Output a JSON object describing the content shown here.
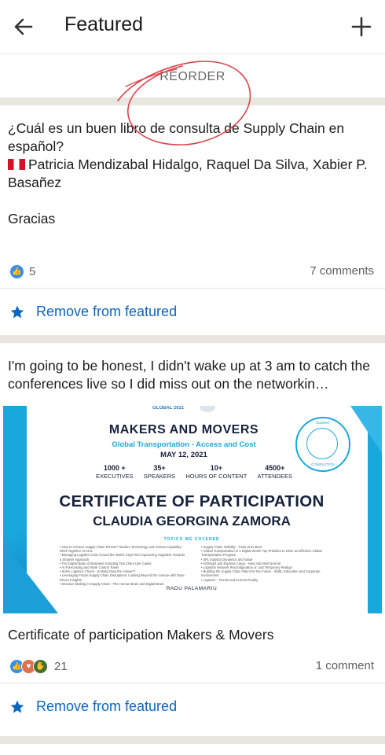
{
  "header": {
    "title": "Featured",
    "back_icon": "arrow-left-icon",
    "add_icon": "plus-icon"
  },
  "reorder": {
    "label": "REORDER"
  },
  "posts": [
    {
      "text_line1": "¿Cuál es un buen libro de consulta de Supply Chain en español?",
      "text_line2": "Patricia Mendizabal Hidalgo, Raquel Da Silva, Xabier P. Basañez",
      "text_line3": "Gracias",
      "reactions_count": "5",
      "comments": "7 comments",
      "remove_label": "Remove from featured"
    },
    {
      "text": "I'm going to be honest, I didn't wake up at 3 am to catch the conferences live so I did miss out on the networkin…",
      "certificate": {
        "logo_text": "GLOBAL 2021",
        "heading": "MAKERS AND MOVERS",
        "subheading": "Global Transportation - Access and Cost",
        "date": "MAY 12, 2021",
        "stats": [
          {
            "value": "1000 +",
            "label": "EXECUTIVES"
          },
          {
            "value": "35+",
            "label": "SPEAKERS"
          },
          {
            "value": "10+",
            "label": "HOURS OF CONTENT"
          },
          {
            "value": "4500+",
            "label": "ATTENDEES"
          }
        ],
        "title": "CERTIFICATE OF PARTICIPATION",
        "recipient": "CLAUDIA GEORGINA ZAMORA",
        "topics_label": "TOPICS WE COVERED",
        "topics_left": [
          "How to Achieve Supply Chain Fitness? Modern Technology and Human Capability - Work Together As One",
          "Managing Logistics Cost Around the World: Keys from Squeezing Suppliers Towards a Smarter Approach",
          "The Digital Brain of Business Including Two Client Use Cases",
          "AI Forecasting and Work Control Tower",
          "Solve Logistics Chaos - Is Mass Data the Answer?",
          "Leveraging Future Supply Chain Disruptions: Looking Beyond the Avenue with Data-Driven Insights",
          "Decision Making in Supply Chain - The Human Brain and Digital Brain"
        ],
        "topics_right": [
          "Supply Chain Visibility - Tools at Its Best",
          "Global Transportation in a Digital World: Top Priorities to Drive an Effective Global Transportation Program",
          "3PL Industry Dynamics and Value",
          "Airfreight and Express Cargo - New and Next Normal",
          "Logistics Network Reconfiguration or Just Temporary Realign",
          "Building the Supply Chain Talent for the Future - Skills, Education and Corporate Involvement",
          "Logitech - Trends and Current Reality"
        ],
        "seal_top": "SUMMIT",
        "seal_bottom": "COMPLETION",
        "signatory": "RADU PALAMARIU"
      },
      "caption": "Certificate of participation Makers & Movers",
      "reactions_count": "21",
      "comments": "1 comment",
      "remove_label": "Remove from featured"
    }
  ],
  "colors": {
    "accent": "#0a66c2",
    "separator": "#e9e5df",
    "cert_blue": "#1aa7de",
    "scribble": "#d9434a"
  }
}
